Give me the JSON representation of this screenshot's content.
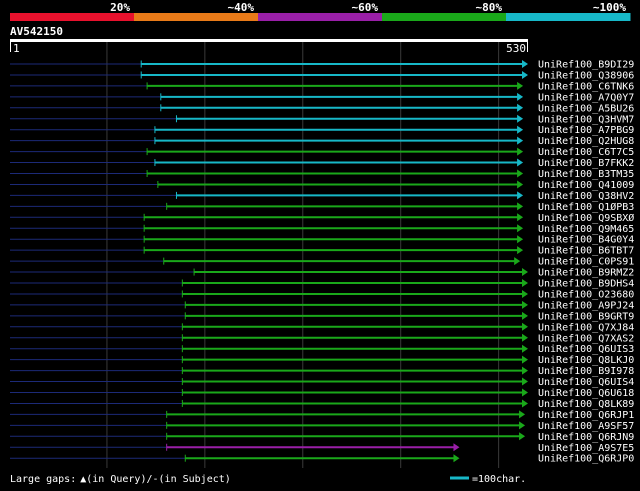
{
  "legend": {
    "labels": [
      "20%",
      "~40%",
      "~60%",
      "~80%",
      "~100%"
    ],
    "colors": [
      "#e8112d",
      "#e87a18",
      "#9a1fa8",
      "#1aa81a",
      "#17b8c8"
    ]
  },
  "query": {
    "name": "AV542150",
    "start_label": "1",
    "end_label": "530",
    "length": 530
  },
  "footer": {
    "large_gaps": "Large gaps:",
    "in_query": "(in Query)/",
    "dash": "-",
    "in_subject": "(in Subject)",
    "scale_label": "=100char."
  },
  "hits": [
    {
      "name": "UniRef100_B9DI29",
      "start": 135,
      "end": 530,
      "color": "#17b8c8"
    },
    {
      "name": "UniRef100_Q38906",
      "start": 135,
      "end": 530,
      "color": "#17b8c8"
    },
    {
      "name": "UniRef100_C6TNK6",
      "start": 141,
      "end": 525,
      "color": "#1aa81a"
    },
    {
      "name": "UniRef100_A7Q0Y7",
      "start": 155,
      "end": 525,
      "color": "#17b8c8"
    },
    {
      "name": "UniRef100_A5BU26",
      "start": 155,
      "end": 525,
      "color": "#17b8c8"
    },
    {
      "name": "UniRef100_Q3HVM7",
      "start": 171,
      "end": 525,
      "color": "#17b8c8"
    },
    {
      "name": "UniRef100_A7PBG9",
      "start": 149,
      "end": 525,
      "color": "#17b8c8"
    },
    {
      "name": "UniRef100_Q2HUG8",
      "start": 149,
      "end": 525,
      "color": "#17b8c8"
    },
    {
      "name": "UniRef100_C6T7C5",
      "start": 141,
      "end": 525,
      "color": "#1aa81a"
    },
    {
      "name": "UniRef100_B7FKK2",
      "start": 149,
      "end": 525,
      "color": "#17b8c8"
    },
    {
      "name": "UniRef100_B3TM35",
      "start": 141,
      "end": 525,
      "color": "#1aa81a"
    },
    {
      "name": "UniRef100_Q41009",
      "start": 152,
      "end": 525,
      "color": "#1aa81a"
    },
    {
      "name": "UniRef100_Q38HV2",
      "start": 171,
      "end": 525,
      "color": "#17b8c8"
    },
    {
      "name": "UniRef100_Q1ØPB3",
      "start": 161,
      "end": 525,
      "color": "#1aa81a"
    },
    {
      "name": "UniRef100_Q9SBXØ",
      "start": 138,
      "end": 525,
      "color": "#1aa81a"
    },
    {
      "name": "UniRef100_Q9M465",
      "start": 138,
      "end": 525,
      "color": "#1aa81a"
    },
    {
      "name": "UniRef100_B4G0Y4",
      "start": 138,
      "end": 525,
      "color": "#1aa81a"
    },
    {
      "name": "UniRef100_B6TBT7",
      "start": 138,
      "end": 525,
      "color": "#1aa81a"
    },
    {
      "name": "UniRef100_C0PS91",
      "start": 158,
      "end": 522,
      "color": "#1aa81a"
    },
    {
      "name": "UniRef100_B9RMZ2",
      "start": 189,
      "end": 530,
      "color": "#1aa81a"
    },
    {
      "name": "UniRef100_B9DHS4",
      "start": 177,
      "end": 530,
      "color": "#1aa81a"
    },
    {
      "name": "UniRef100_O23680",
      "start": 177,
      "end": 530,
      "color": "#1aa81a"
    },
    {
      "name": "UniRef100_A9PJ24",
      "start": 180,
      "end": 530,
      "color": "#1aa81a"
    },
    {
      "name": "UniRef100_B9GRT9",
      "start": 180,
      "end": 530,
      "color": "#1aa81a"
    },
    {
      "name": "UniRef100_Q7XJ84",
      "start": 177,
      "end": 530,
      "color": "#1aa81a"
    },
    {
      "name": "UniRef100_Q7XAS2",
      "start": 177,
      "end": 530,
      "color": "#1aa81a"
    },
    {
      "name": "UniRef100_Q6UIS3",
      "start": 177,
      "end": 530,
      "color": "#1aa81a"
    },
    {
      "name": "UniRef100_Q8LKJ0",
      "start": 177,
      "end": 530,
      "color": "#1aa81a"
    },
    {
      "name": "UniRef100_B9I978",
      "start": 177,
      "end": 530,
      "color": "#1aa81a"
    },
    {
      "name": "UniRef100_Q6UIS4",
      "start": 177,
      "end": 530,
      "color": "#1aa81a"
    },
    {
      "name": "UniRef100_Q6U618",
      "start": 177,
      "end": 530,
      "color": "#1aa81a"
    },
    {
      "name": "UniRef100_Q8LK89",
      "start": 177,
      "end": 530,
      "color": "#1aa81a"
    },
    {
      "name": "UniRef100_Q6RJP1",
      "start": 161,
      "end": 527,
      "color": "#1aa81a"
    },
    {
      "name": "UniRef100_A9SF57",
      "start": 161,
      "end": 527,
      "color": "#1aa81a"
    },
    {
      "name": "UniRef100_Q6RJN9",
      "start": 161,
      "end": 527,
      "color": "#1aa81a"
    },
    {
      "name": "UniRef100_A9S7E5",
      "start": 161,
      "end": 460,
      "color": "#9a1fa8"
    },
    {
      "name": "UniRef100_Q6RJP0",
      "start": 180,
      "end": 460,
      "color": "#1aa81a"
    }
  ]
}
